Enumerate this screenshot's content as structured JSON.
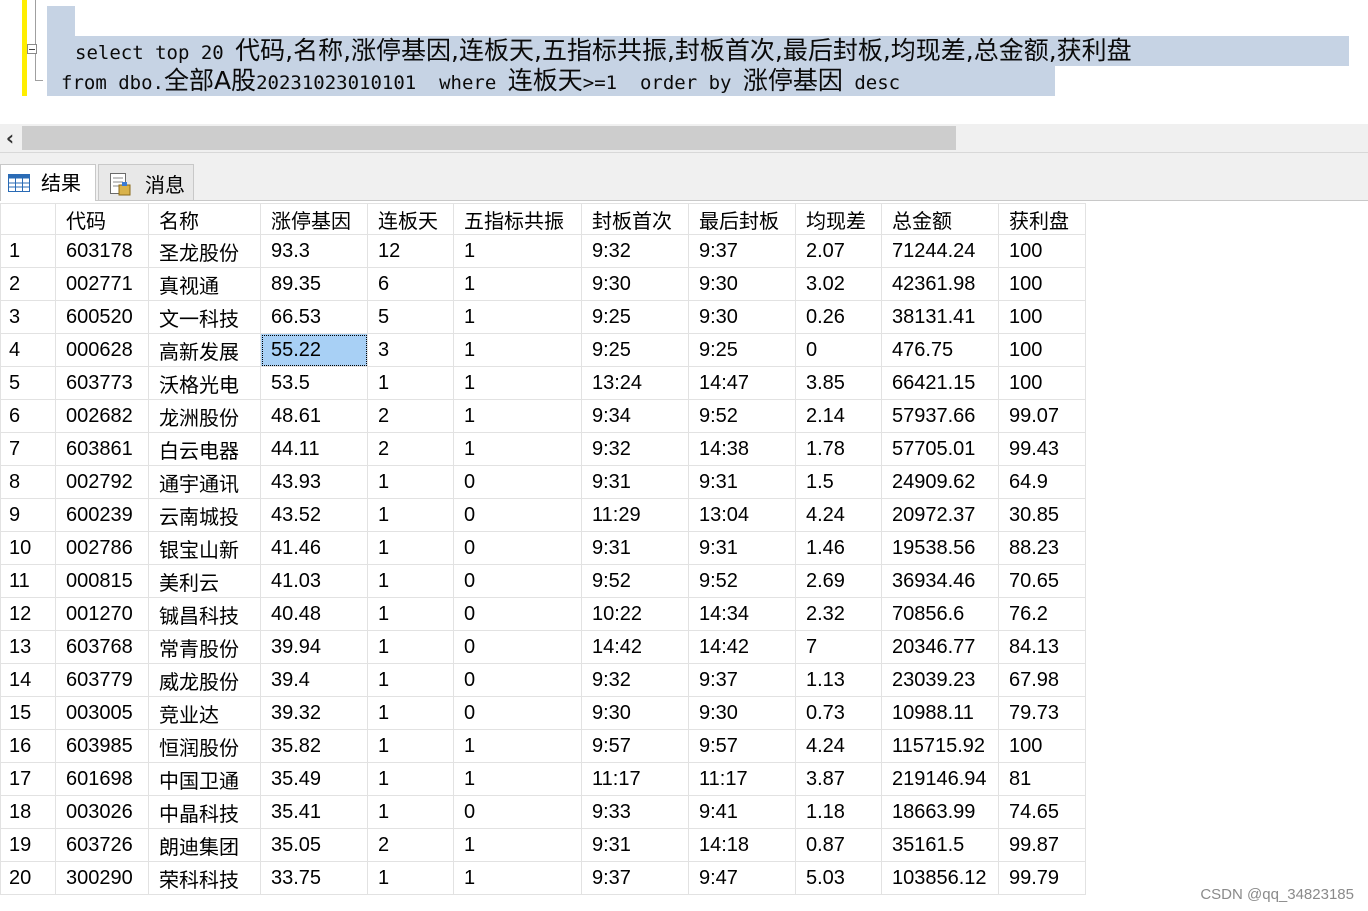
{
  "editor": {
    "line1_keyword": "select top 20 ",
    "line1_columns": "代码,名称,涨停基因,连板天,五指标共振,封板首次,最后封板,均现差,总金额,获利盘",
    "line2_from": "from dbo.",
    "line2_table_cjk": "全部A股",
    "line2_table_suffix": "20231023010101  where ",
    "line2_cond_col": "连板天",
    "line2_cond": ">=1  order by ",
    "line2_order_col": "涨停基因",
    "line2_order_dir": " desc"
  },
  "tabs": [
    {
      "label": "结果"
    },
    {
      "label": "消息"
    }
  ],
  "grid": {
    "columns": [
      "",
      "代码",
      "名称",
      "涨停基因",
      "连板天",
      "五指标共振",
      "封板首次",
      "最后封板",
      "均现差",
      "总金额",
      "获利盘"
    ],
    "rows": [
      [
        "1",
        "603178",
        "圣龙股份",
        "93.3",
        "12",
        "1",
        "9:32",
        "9:37",
        "2.07",
        "71244.24",
        "100"
      ],
      [
        "2",
        "002771",
        "真视通",
        "89.35",
        "6",
        "1",
        "9:30",
        "9:30",
        "3.02",
        "42361.98",
        "100"
      ],
      [
        "3",
        "600520",
        "文一科技",
        "66.53",
        "5",
        "1",
        "9:25",
        "9:30",
        "0.26",
        "38131.41",
        "100"
      ],
      [
        "4",
        "000628",
        "高新发展",
        "55.22",
        "3",
        "1",
        "9:25",
        "9:25",
        "0",
        "476.75",
        "100"
      ],
      [
        "5",
        "603773",
        "沃格光电",
        "53.5",
        "1",
        "1",
        "13:24",
        "14:47",
        "3.85",
        "66421.15",
        "100"
      ],
      [
        "6",
        "002682",
        "龙洲股份",
        "48.61",
        "2",
        "1",
        "9:34",
        "9:52",
        "2.14",
        "57937.66",
        "99.07"
      ],
      [
        "7",
        "603861",
        "白云电器",
        "44.11",
        "2",
        "1",
        "9:32",
        "14:38",
        "1.78",
        "57705.01",
        "99.43"
      ],
      [
        "8",
        "002792",
        "通宇通讯",
        "43.93",
        "1",
        "0",
        "9:31",
        "9:31",
        "1.5",
        "24909.62",
        "64.9"
      ],
      [
        "9",
        "600239",
        "云南城投",
        "43.52",
        "1",
        "0",
        "11:29",
        "13:04",
        "4.24",
        "20972.37",
        "30.85"
      ],
      [
        "10",
        "002786",
        "银宝山新",
        "41.46",
        "1",
        "0",
        "9:31",
        "9:31",
        "1.46",
        "19538.56",
        "88.23"
      ],
      [
        "11",
        "000815",
        "美利云",
        "41.03",
        "1",
        "0",
        "9:52",
        "9:52",
        "2.69",
        "36934.46",
        "70.65"
      ],
      [
        "12",
        "001270",
        "铖昌科技",
        "40.48",
        "1",
        "0",
        "10:22",
        "14:34",
        "2.32",
        "70856.6",
        "76.2"
      ],
      [
        "13",
        "603768",
        "常青股份",
        "39.94",
        "1",
        "0",
        "14:42",
        "14:42",
        "7",
        "20346.77",
        "84.13"
      ],
      [
        "14",
        "603779",
        "威龙股份",
        "39.4",
        "1",
        "0",
        "9:32",
        "9:37",
        "1.13",
        "23039.23",
        "67.98"
      ],
      [
        "15",
        "003005",
        "竞业达",
        "39.32",
        "1",
        "0",
        "9:30",
        "9:30",
        "0.73",
        "10988.11",
        "79.73"
      ],
      [
        "16",
        "603985",
        "恒润股份",
        "35.82",
        "1",
        "1",
        "9:57",
        "9:57",
        "4.24",
        "115715.92",
        "100"
      ],
      [
        "17",
        "601698",
        "中国卫通",
        "35.49",
        "1",
        "1",
        "11:17",
        "11:17",
        "3.87",
        "219146.94",
        "81"
      ],
      [
        "18",
        "003026",
        "中晶科技",
        "35.41",
        "1",
        "0",
        "9:33",
        "9:41",
        "1.18",
        "18663.99",
        "74.65"
      ],
      [
        "19",
        "603726",
        "朗迪集团",
        "35.05",
        "2",
        "1",
        "9:31",
        "14:18",
        "0.87",
        "35161.5",
        "99.87"
      ],
      [
        "20",
        "300290",
        "荣科科技",
        "33.75",
        "1",
        "1",
        "9:37",
        "9:47",
        "5.03",
        "103856.12",
        "99.79"
      ]
    ],
    "selected_cell": {
      "row": 3,
      "col": 3
    }
  },
  "watermark": "CSDN @qq_34823185",
  "colors": {
    "selection_bg": "#c6d3e4",
    "cell_selected": "#a8d0f5",
    "yellow_margin": "#ffee00"
  }
}
